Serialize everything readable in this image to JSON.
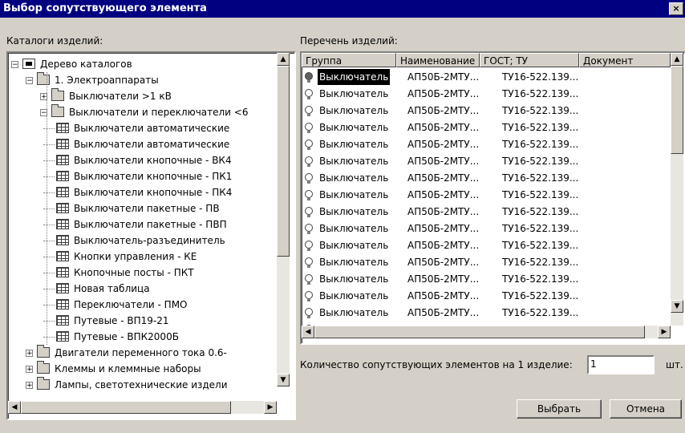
{
  "window": {
    "title": "Выбор сопутствующего элемента",
    "close_label": "×"
  },
  "left": {
    "label": "Каталоги изделий:",
    "tree": [
      {
        "level": 0,
        "icon": "root-icon",
        "expander": "−",
        "label": "Дерево каталогов"
      },
      {
        "level": 1,
        "icon": "folder-icon",
        "expander": "−",
        "label": "1. Электроаппараты"
      },
      {
        "level": 2,
        "icon": "folder-icon",
        "expander": "+",
        "label": "Выключатели >1 кВ"
      },
      {
        "level": 2,
        "icon": "folder-icon",
        "expander": "−",
        "label": "Выключатели и переключатели <6"
      },
      {
        "level": 3,
        "icon": "table-icon",
        "expander": "",
        "label": "Выключатели автоматические"
      },
      {
        "level": 3,
        "icon": "table-icon",
        "expander": "",
        "label": "Выключатели автоматические"
      },
      {
        "level": 3,
        "icon": "table-icon",
        "expander": "",
        "label": "Выключатели кнопочные - ВК4"
      },
      {
        "level": 3,
        "icon": "table-icon",
        "expander": "",
        "label": "Выключатели кнопочные - ПК1"
      },
      {
        "level": 3,
        "icon": "table-icon",
        "expander": "",
        "label": "Выключатели кнопочные - ПК4"
      },
      {
        "level": 3,
        "icon": "table-icon",
        "expander": "",
        "label": "Выключатели пакетные - ПВ"
      },
      {
        "level": 3,
        "icon": "table-icon",
        "expander": "",
        "label": "Выключатели пакетные - ПВП"
      },
      {
        "level": 3,
        "icon": "table-icon",
        "expander": "",
        "label": "Выключатель-разъединитель"
      },
      {
        "level": 3,
        "icon": "table-icon",
        "expander": "",
        "label": "Кнопки управления - КЕ"
      },
      {
        "level": 3,
        "icon": "table-icon",
        "expander": "",
        "label": "Кнопочные посты - ПКТ"
      },
      {
        "level": 3,
        "icon": "table-icon",
        "expander": "",
        "label": "Новая таблица"
      },
      {
        "level": 3,
        "icon": "table-icon",
        "expander": "",
        "label": "Переключатели - ПМО"
      },
      {
        "level": 3,
        "icon": "table-icon",
        "expander": "",
        "label": "Путевые - ВП19-21"
      },
      {
        "level": 3,
        "icon": "table-icon",
        "expander": "",
        "label": "Путевые - ВПК2000Б"
      },
      {
        "level": 1,
        "icon": "folder-icon",
        "expander": "+",
        "label": "Двигатели переменного тока 0.6-"
      },
      {
        "level": 1,
        "icon": "folder-icon",
        "expander": "+",
        "label": "Клеммы и клеммные наборы"
      },
      {
        "level": 1,
        "icon": "folder-icon",
        "expander": "+",
        "label": "Лампы, светотехнические издели"
      }
    ]
  },
  "right": {
    "label": "Перечень изделий:",
    "columns": [
      "Группа",
      "Наименование",
      "ГОСТ; ТУ",
      "Документ"
    ],
    "rows": [
      {
        "group": "Выключатель",
        "name": "АП50Б-2МТУ...",
        "gost": "ТУ16-522.139...",
        "doc": "",
        "selected": true
      },
      {
        "group": "Выключатель",
        "name": "АП50Б-2МТУ...",
        "gost": "ТУ16-522.139...",
        "doc": ""
      },
      {
        "group": "Выключатель",
        "name": "АП50Б-2МТУ...",
        "gost": "ТУ16-522.139...",
        "doc": ""
      },
      {
        "group": "Выключатель",
        "name": "АП50Б-2МТУ...",
        "gost": "ТУ16-522.139...",
        "doc": ""
      },
      {
        "group": "Выключатель",
        "name": "АП50Б-2МТУ...",
        "gost": "ТУ16-522.139...",
        "doc": ""
      },
      {
        "group": "Выключатель",
        "name": "АП50Б-2МТУ...",
        "gost": "ТУ16-522.139...",
        "doc": ""
      },
      {
        "group": "Выключатель",
        "name": "АП50Б-2МТУ...",
        "gost": "ТУ16-522.139...",
        "doc": ""
      },
      {
        "group": "Выключатель",
        "name": "АП50Б-2МТУ...",
        "gost": "ТУ16-522.139...",
        "doc": ""
      },
      {
        "group": "Выключатель",
        "name": "АП50Б-2МТУ...",
        "gost": "ТУ16-522.139...",
        "doc": ""
      },
      {
        "group": "Выключатель",
        "name": "АП50Б-2МТУ...",
        "gost": "ТУ16-522.139...",
        "doc": ""
      },
      {
        "group": "Выключатель",
        "name": "АП50Б-2МТУ...",
        "gost": "ТУ16-522.139...",
        "doc": ""
      },
      {
        "group": "Выключатель",
        "name": "АП50Б-2МТУ...",
        "gost": "ТУ16-522.139...",
        "doc": ""
      },
      {
        "group": "Выключатель",
        "name": "АП50Б-2МТУ...",
        "gost": "ТУ16-522.139...",
        "doc": ""
      },
      {
        "group": "Выключатель",
        "name": "АП50Б-2МТУ...",
        "gost": "ТУ16-522.139...",
        "doc": ""
      },
      {
        "group": "Выключатель",
        "name": "АП50Б-2МТУ...",
        "gost": "ТУ16-522.139...",
        "doc": ""
      },
      {
        "group": "Выключатель",
        "name": "АП50Б-2МТУ...",
        "gost": "ТУ16-522.139...",
        "doc": ""
      }
    ]
  },
  "quantity": {
    "label": "Количество сопутствующих элементов на 1 изделие:",
    "value": "1",
    "unit": "шт."
  },
  "buttons": {
    "select": "Выбрать",
    "cancel": "Отмена"
  }
}
